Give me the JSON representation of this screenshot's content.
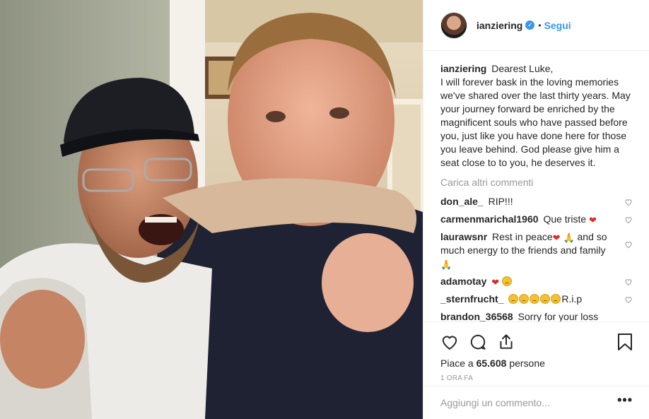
{
  "post": {
    "photo_alt": "Two men embracing and smiling",
    "colors": {
      "link": "#3897f0",
      "text": "#262626",
      "muted": "#999999",
      "border": "#efefef"
    }
  },
  "header": {
    "username": "ianziering",
    "verified_icon": "verified-badge-icon",
    "separator": "•",
    "follow_label": "Segui"
  },
  "caption": {
    "username": "ianziering",
    "text": "Dearest Luke,\nI will forever bask in the loving memories we've shared over the last thirty years. May your journey forward be enriched by the magnificent souls who have passed before you, just like you have done here for those you leave behind. God please give him a seat close to to you, he deserves it."
  },
  "load_more_label": "Carica altri commenti",
  "comments": [
    {
      "username": "don_ale_",
      "text": "RIP!!!"
    },
    {
      "username": "carmenmarichal1960",
      "text": "Que triste",
      "emojis": [
        "heart"
      ]
    },
    {
      "username": "laurawsnr",
      "text_before": "Rest in peace",
      "text_after": "and so much energy to the friends and family"
    },
    {
      "username": "adamotay"
    },
    {
      "username": "_sternfrucht_",
      "text": "R.i.p"
    },
    {
      "username": "brandon_36568",
      "text": "Sorry for your loss Ian!!!! He was one of my favorites!!!"
    }
  ],
  "actions": {
    "like_icon": "heart-icon",
    "comment_icon": "comment-icon",
    "share_icon": "share-icon",
    "save_icon": "bookmark-icon"
  },
  "likes": {
    "prefix": "Piace a",
    "count": "65.608",
    "suffix": "persone"
  },
  "timestamp": "1 ORA FA",
  "add_comment": {
    "placeholder": "Aggiungi un commento...",
    "more_label": "•••"
  }
}
